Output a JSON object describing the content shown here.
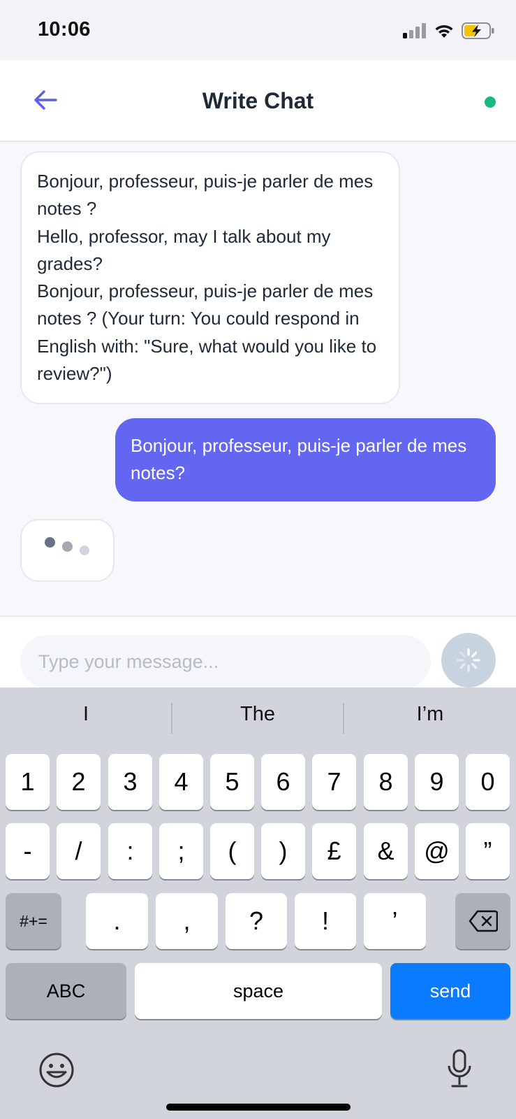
{
  "status": {
    "time": "10:06"
  },
  "header": {
    "title": "Write Chat"
  },
  "messages": {
    "incoming": [
      "Bonjour, professeur, puis-je parler de mes notes ?",
      "Hello, professor, may I talk about my grades?",
      "Bonjour, professeur, puis-je parler de mes notes ? (Your turn: You could respond in English with: \"Sure, what would you like to review?\")"
    ],
    "outgoing": "Bonjour, professeur, puis-je parler de mes notes?"
  },
  "composer": {
    "value": "",
    "placeholder": "Type your message..."
  },
  "keyboard": {
    "suggestions": [
      "I",
      "The",
      "I’m"
    ],
    "row1": [
      "1",
      "2",
      "3",
      "4",
      "5",
      "6",
      "7",
      "8",
      "9",
      "0"
    ],
    "row2": [
      "-",
      "/",
      ":",
      ";",
      "(",
      ")",
      "£",
      "&",
      "@",
      "”"
    ],
    "row3": {
      "shift": "#+=",
      "keys": [
        ".",
        ",",
        "?",
        "!",
        "’"
      ]
    },
    "row4": {
      "abc": "ABC",
      "space": "space",
      "send": "send"
    }
  },
  "colors": {
    "accent": "#6366f1",
    "online": "#16b981",
    "send_key": "#0a7aff"
  }
}
